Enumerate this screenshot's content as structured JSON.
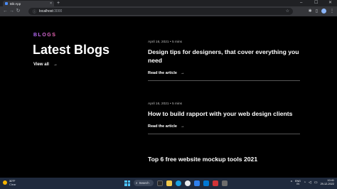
{
  "browser": {
    "tab_title": "Blit App",
    "tab_close": "×",
    "new_tab": "+",
    "url_host": "localhost",
    "url_port": ":3000",
    "win_controls": [
      "–",
      "☐",
      "✕"
    ]
  },
  "blogs": {
    "kicker": "BLOGS",
    "heading": "Latest Blogs",
    "view_all": "View all",
    "arrow": "→",
    "articles": [
      {
        "meta": "April 16, 2021  • 5 mins",
        "title": "Design tips for designers, that cover everything you need",
        "read": "Read the article"
      },
      {
        "meta": "April 16, 2021  • 5 mins",
        "title": "How to build rapport with your web design clients",
        "read": "Read the article"
      },
      {
        "meta": "",
        "title": "Top 6 free website mockup tools 2021",
        "read": ""
      }
    ]
  },
  "taskbar": {
    "temp": "30°F",
    "condition": "Clear",
    "search_label": "Search",
    "lang_top": "ENG",
    "lang_bottom": "IN",
    "time": "10:41",
    "date": "29-12-2022"
  },
  "colors": {
    "kicker_gradient_start": "#b06bff",
    "kicker_gradient_end": "#ff6bb5",
    "taskbar": "#1f2a3d"
  }
}
